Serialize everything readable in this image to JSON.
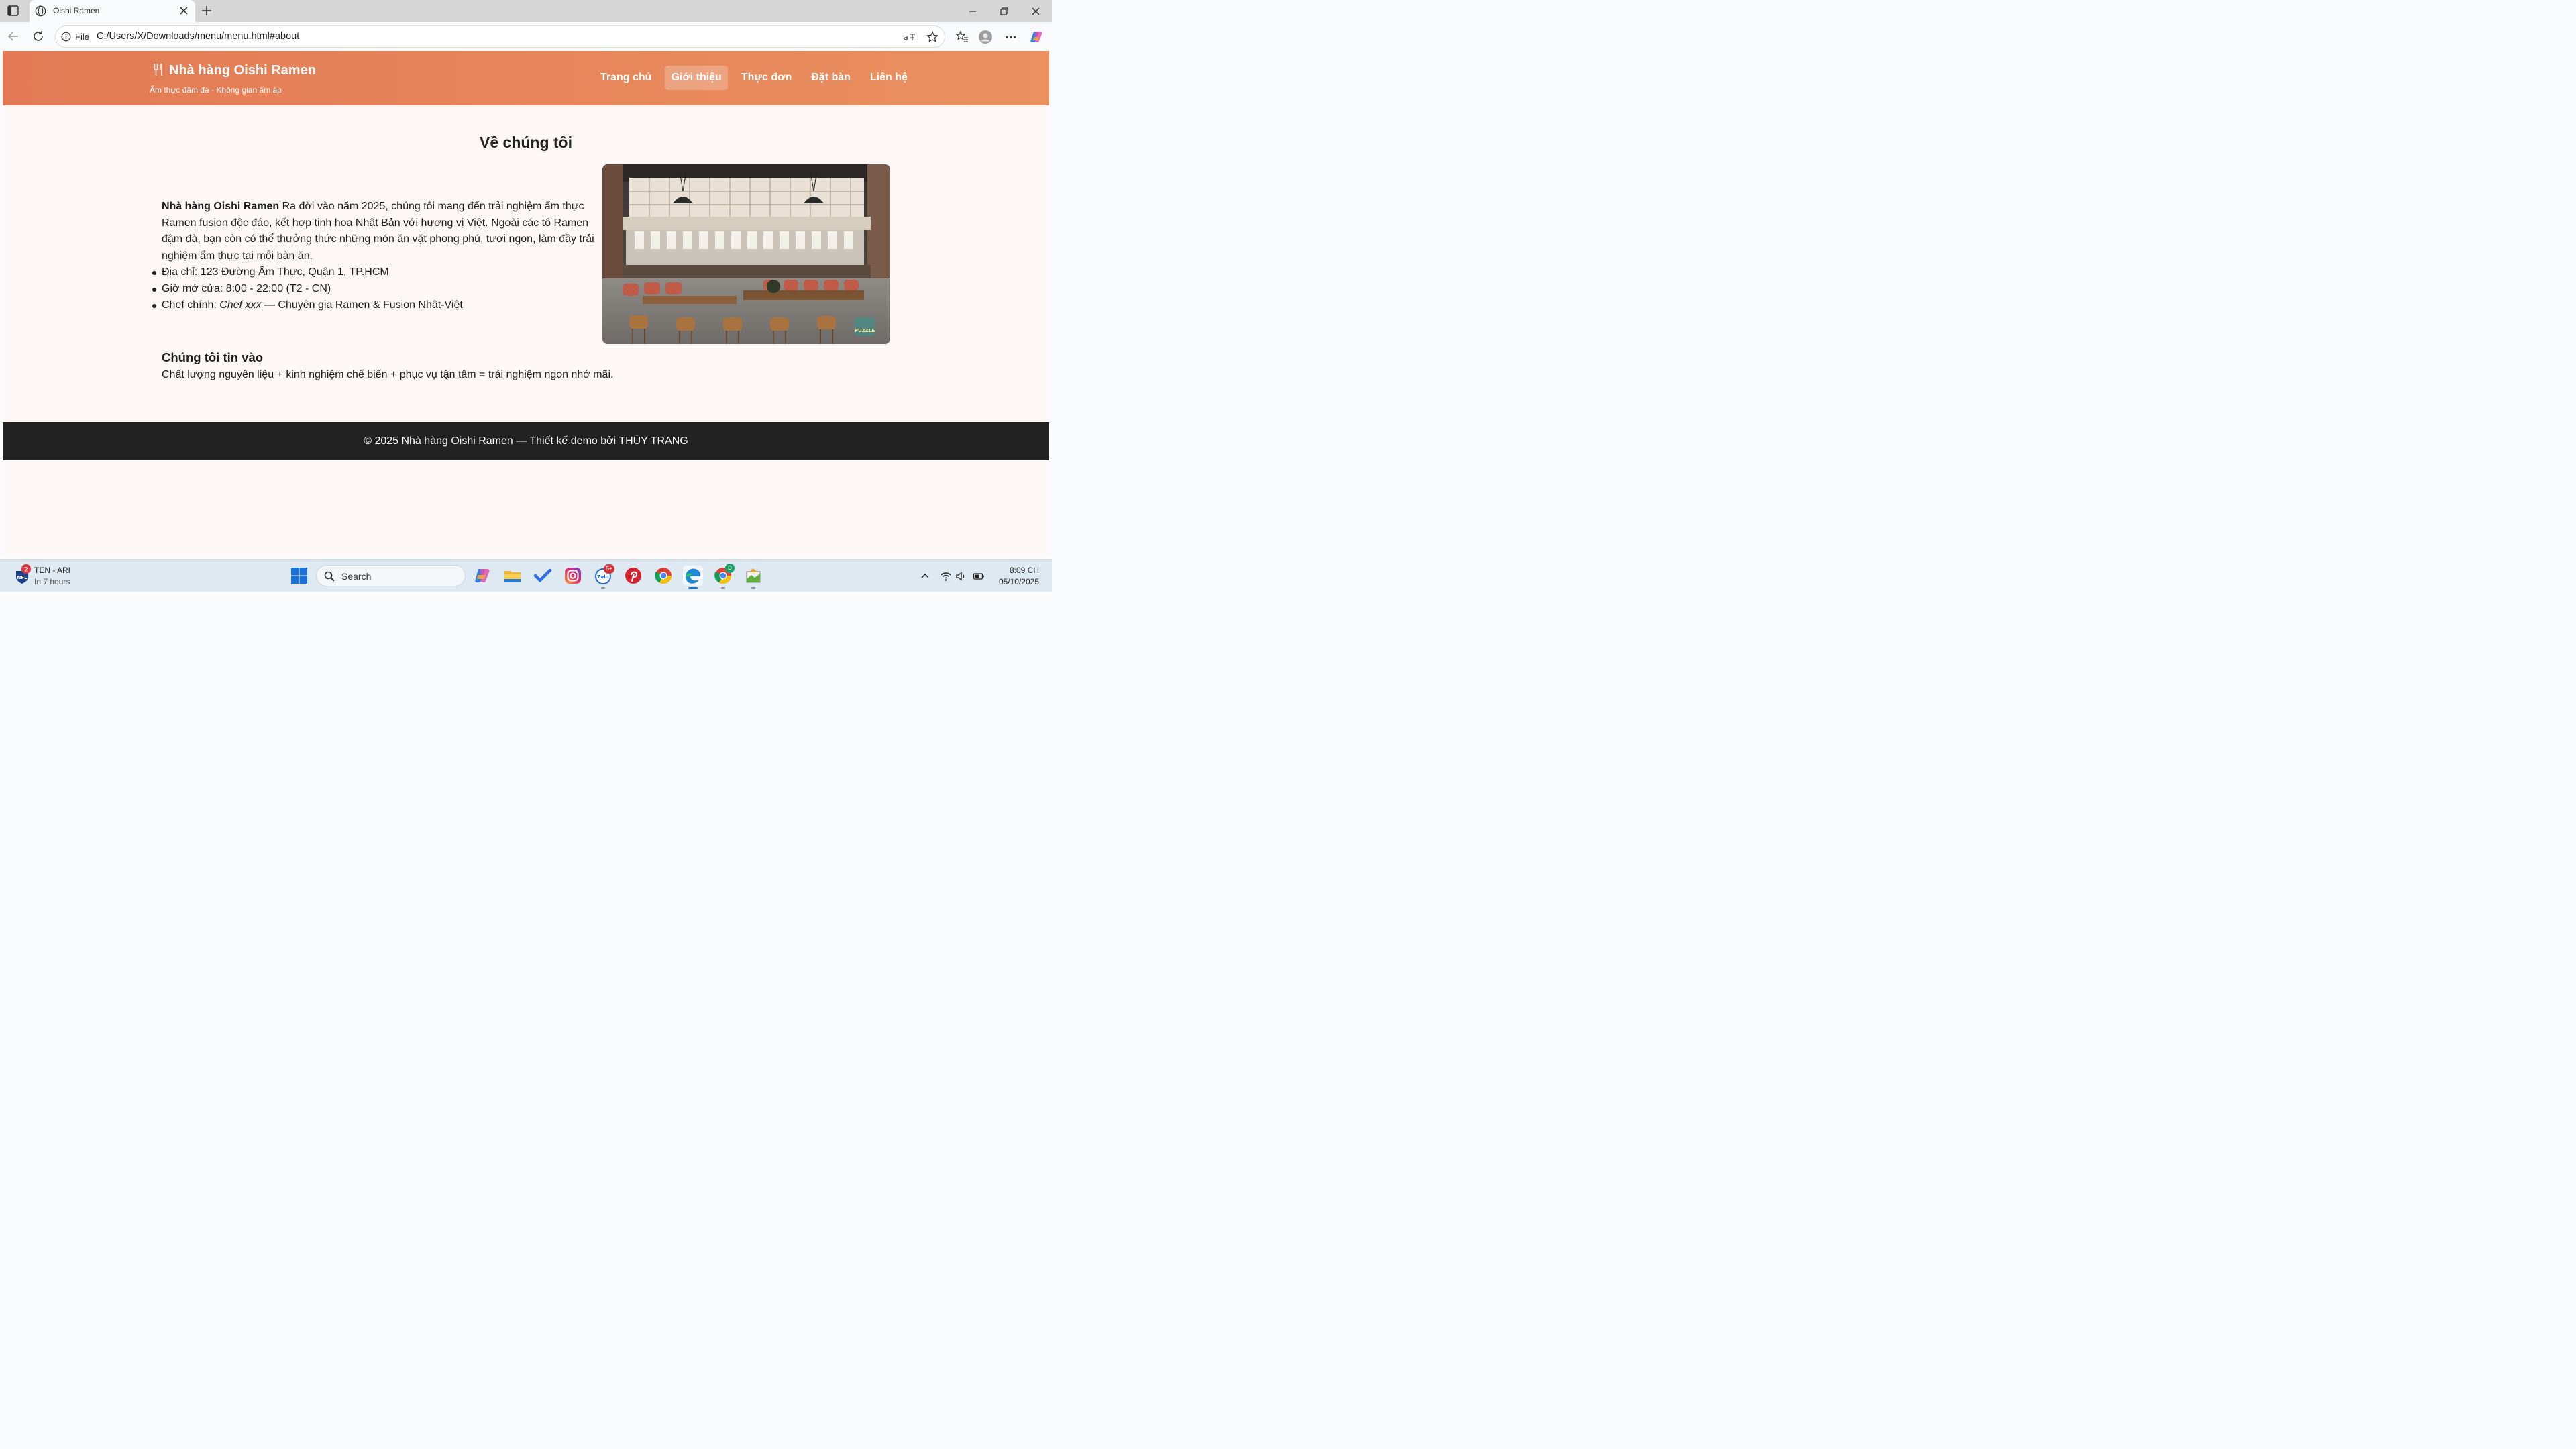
{
  "browser": {
    "tab_title": "Oishi Ramen",
    "address_scheme_label": "File",
    "address_url": "C:/Users/X/Downloads/menu/menu.html#about",
    "icons": [
      "sidebar-toggle-icon",
      "globe-icon",
      "close-icon",
      "plus-icon",
      "minimize-icon",
      "restore-icon",
      "window-close-icon",
      "back-icon",
      "reload-icon",
      "info-icon",
      "read-aloud-icon",
      "favorite-star-icon",
      "favorites-list-icon",
      "profile-icon",
      "more-icon",
      "copilot-icon"
    ]
  },
  "site": {
    "brand": "Nhà hàng Oishi Ramen",
    "tagline": "Ẩm thực đậm đà - Không gian ấm áp",
    "nav": [
      "Trang chủ",
      "Giới thiệu",
      "Thực đơn",
      "Đặt bàn",
      "Liên hệ"
    ],
    "nav_active_index": 1,
    "accent_start": "#e37a55",
    "accent_end": "#ea915f",
    "about": {
      "title": "Về chúng tôi",
      "intro_bold": "Nhà hàng Oishi Ramen",
      "intro_text": " Ra đời vào năm 2025, chúng tôi mang đến trải nghiệm ẩm thực Ramen fusion độc đáo, kết hợp tinh hoa Nhật Bản với hương vị Việt. Ngoài các tô Ramen đậm đà, bạn còn có thể thưởng thức những món ăn vặt phong phú, tươi ngon, làm đầy trải nghiệm ẩm thực tại mỗi bàn ăn.",
      "address": "Địa chỉ: 123 Đường Ẩm Thực, Quận 1, TP.HCM",
      "hours": "Giờ mở cửa: 8:00 - 22:00 (T2 - CN)",
      "chef_label": "Chef chính: ",
      "chef_name": "Chef xxx",
      "chef_desc": " — Chuyên gia Ramen & Fusion Nhật-Việt",
      "photo_watermark": "PUZZLE"
    },
    "belief": {
      "title": "Chúng tôi tin vào",
      "text": "Chất lượng nguyên liệu + kinh nghiệm chế biến + phục vụ tận tâm = trải nghiệm ngon nhớ mãi."
    },
    "footer": "© 2025 Nhà hàng Oishi Ramen — Thiết kế demo bởi THÙY TRANG"
  },
  "taskbar": {
    "weather_badge": "2",
    "weather_line1": "TEN - ARI",
    "weather_line2": "In 7 hours",
    "search_placeholder": "Search",
    "zalo_badge": "5+",
    "chrome_profile_badge": "D",
    "time": "8:09 CH",
    "date": "05/10/2025",
    "apps": [
      "windows-start-icon",
      "copilot-app-icon",
      "file-explorer-icon",
      "todo-icon",
      "instagram-icon",
      "zalo-icon",
      "pinterest-icon",
      "chrome-icon",
      "edge-icon",
      "chrome-profile-icon",
      "app-icon"
    ]
  }
}
